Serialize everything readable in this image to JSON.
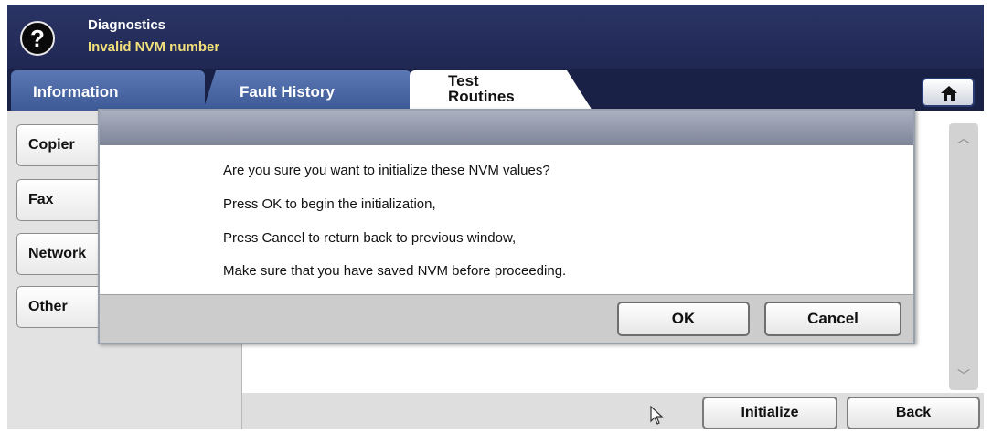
{
  "header": {
    "title": "Diagnostics",
    "subtitle": "Invalid NVM number",
    "help_icon": "question-circle-icon"
  },
  "tabs": [
    {
      "label": "Information",
      "active": false
    },
    {
      "label": "Fault History",
      "active": false
    },
    {
      "label": "Test Routines",
      "active": true
    }
  ],
  "home_icon": "home-icon",
  "sidebar": {
    "items": [
      {
        "label": "Copier"
      },
      {
        "label": "Fax"
      },
      {
        "label": "Network"
      },
      {
        "label": "Other"
      }
    ]
  },
  "dialog": {
    "lines": [
      "Are you sure you want to initialize these NVM values?",
      "Press OK to begin the initialization,",
      "Press Cancel to return back to previous window,",
      "Make sure that you have saved NVM before proceeding."
    ],
    "ok_label": "OK",
    "cancel_label": "Cancel"
  },
  "footer": {
    "initialize_label": "Initialize",
    "back_label": "Back"
  },
  "colors": {
    "header_bg": "#2b3566",
    "subtitle": "#f2e07a",
    "tab_bg": "#4b68a6",
    "dialog_titlebar": "#8f96a8"
  }
}
